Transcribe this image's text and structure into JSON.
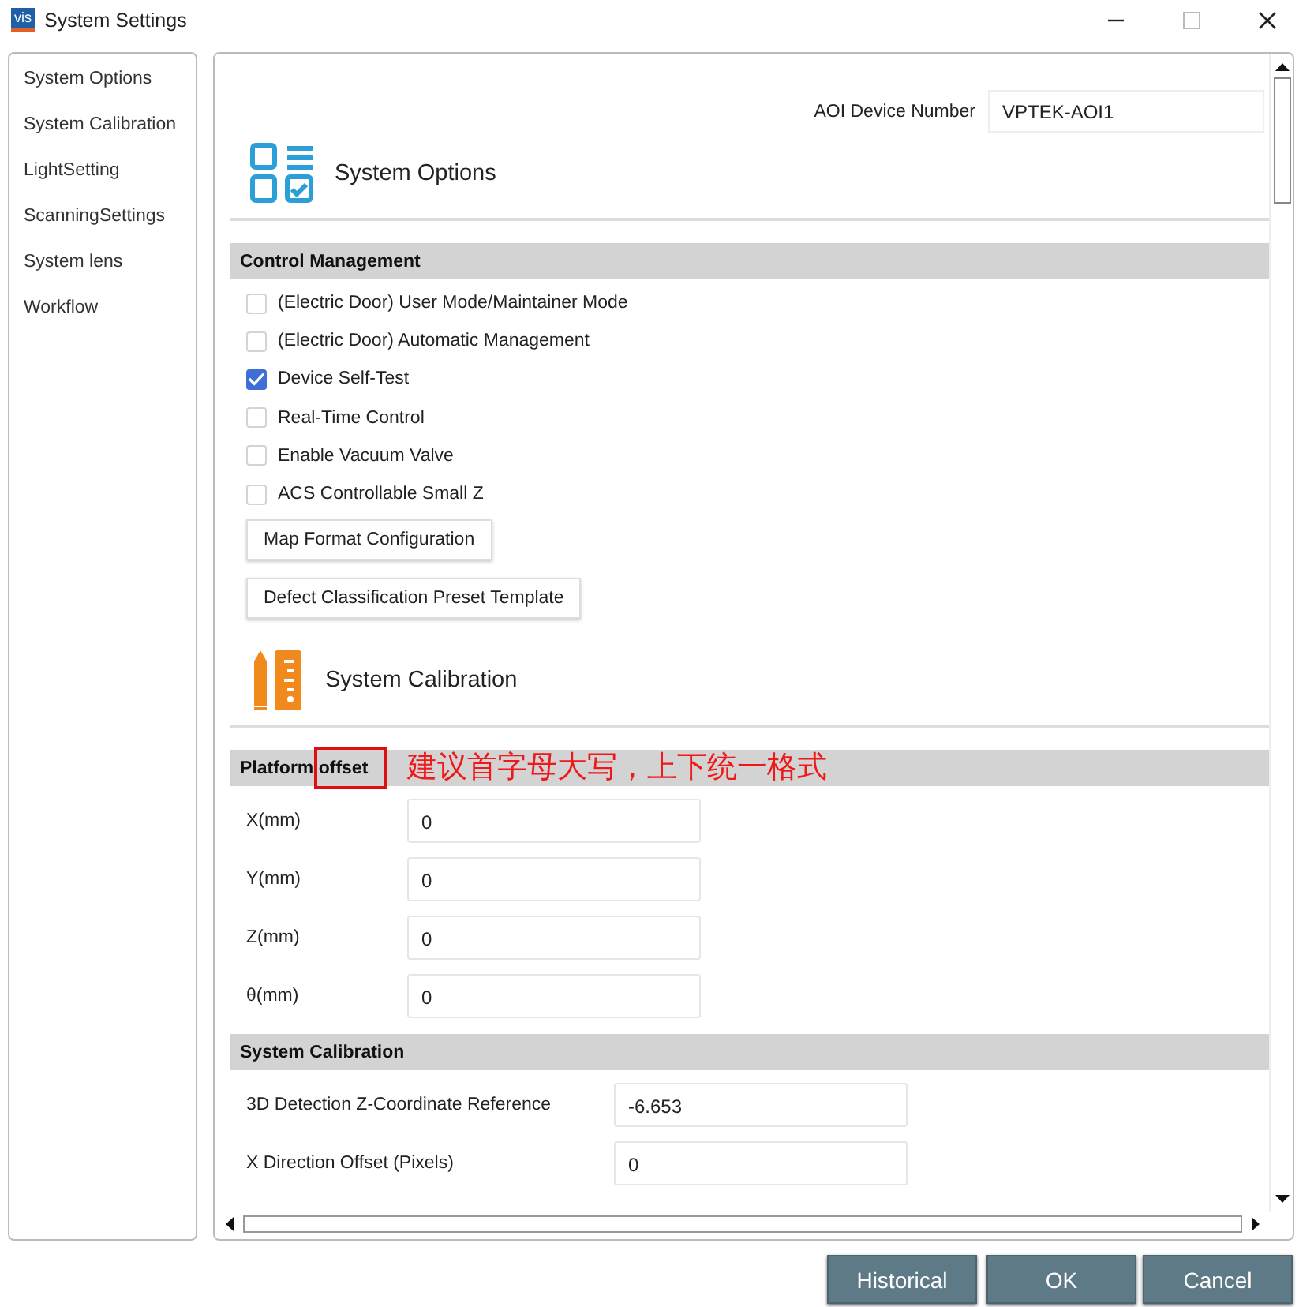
{
  "window": {
    "title": "System Settings",
    "app_badge": "vis"
  },
  "sidebar": {
    "items": [
      "System Options",
      "System Calibration",
      "LightSetting",
      "ScanningSettings",
      "System lens",
      "Workflow"
    ]
  },
  "device": {
    "label": "AOI Device Number",
    "value": "VPTEK-AOI1"
  },
  "sections": [
    {
      "title": "System Options",
      "groups": [
        {
          "header": "Control Management",
          "items": [
            {
              "kind": "checkbox",
              "label": "(Electric Door) User Mode/Maintainer Mode",
              "checked": false
            },
            {
              "kind": "checkbox",
              "label": "(Electric Door) Automatic Management",
              "checked": false
            },
            {
              "kind": "checkbox",
              "label": "Device Self-Test",
              "checked": true
            },
            {
              "kind": "checkbox",
              "label": "Real-Time Control",
              "checked": false
            },
            {
              "kind": "checkbox",
              "label": "Enable Vacuum Valve",
              "checked": false
            },
            {
              "kind": "checkbox",
              "label": "ACS Controllable Small Z",
              "checked": false
            },
            {
              "kind": "button",
              "label": "Map Format Configuration"
            },
            {
              "kind": "button",
              "label": "Defect Classification Preset Template"
            }
          ]
        }
      ]
    },
    {
      "title": "System Calibration",
      "groups": [
        {
          "header": "Platform offset",
          "annotation": "建议首字母大写，上下统一格式",
          "items": [
            {
              "kind": "number",
              "label": "X(mm)",
              "value": "0"
            },
            {
              "kind": "number",
              "label": "Y(mm)",
              "value": "0"
            },
            {
              "kind": "number",
              "label": "Z(mm)",
              "value": "0"
            },
            {
              "kind": "number",
              "label": "θ(mm)",
              "value": "0"
            }
          ]
        },
        {
          "header": "System Calibration",
          "items": [
            {
              "kind": "number",
              "label": "3D Detection Z-Coordinate Reference",
              "value": "-6.653"
            },
            {
              "kind": "number",
              "label": "X Direction Offset (Pixels)",
              "value": "0"
            }
          ]
        }
      ]
    }
  ],
  "buttons": [
    "Historical",
    "OK",
    "Cancel"
  ]
}
